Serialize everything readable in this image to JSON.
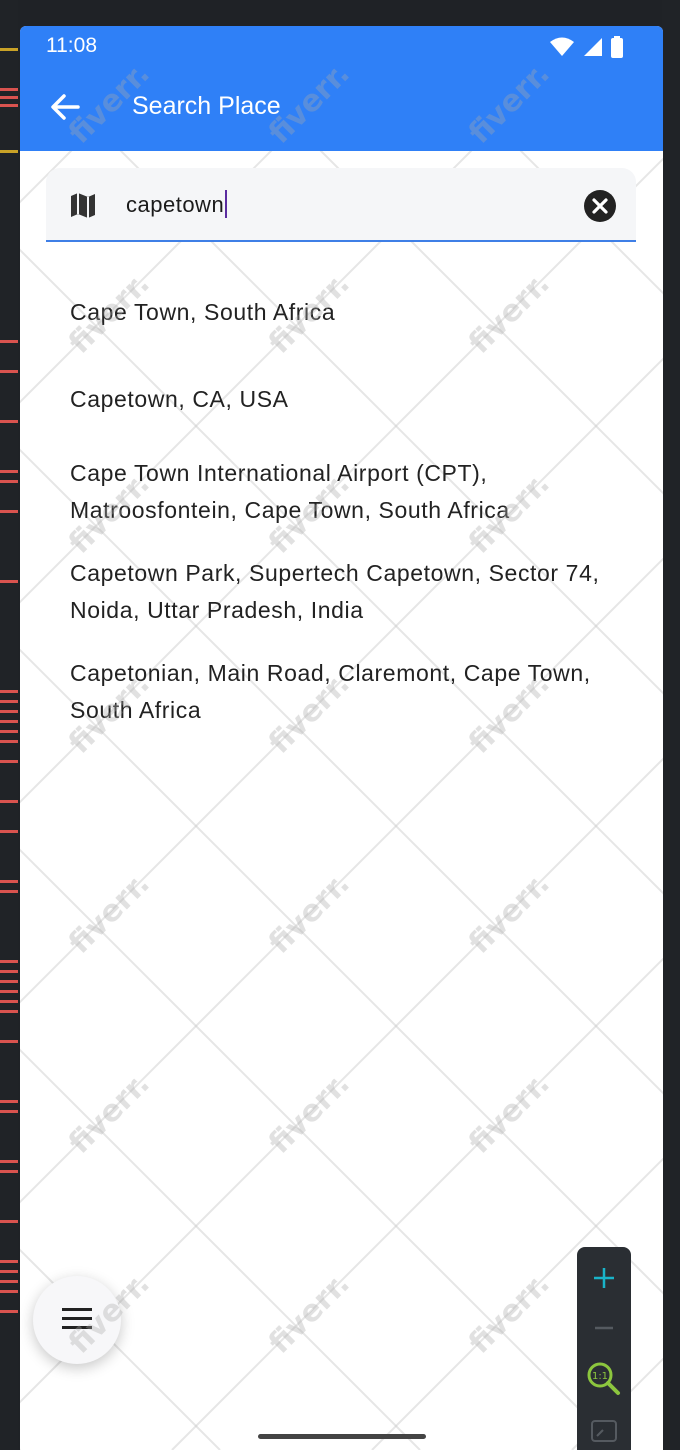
{
  "status_bar": {
    "time": "11:08"
  },
  "app_bar": {
    "title": "Search Place"
  },
  "search": {
    "query": "capetown"
  },
  "results": [
    "Cape Town, South Africa",
    "Capetown, CA, USA",
    "Cape Town International Airport (CPT), Matroosfontein, Cape Town, South Africa",
    "Capetown Park, Supertech Capetown, Sector 74, Noida, Uttar Pradesh, India",
    "Capetonian, Main Road, Claremont, Cape Town, South Africa"
  ],
  "zoom_controls": {
    "zoom_in": "+",
    "zoom_out": "−",
    "reset_label": "1:1"
  },
  "watermark": "fiverr.",
  "colors": {
    "app_bar": "#2f80f7",
    "search_underline": "#3f7fe6",
    "zoom_in": "#19b3c9",
    "zoom_reset": "#8cc63e"
  },
  "icons": [
    "arrow-back-icon",
    "map-icon",
    "clear-icon",
    "wifi-icon",
    "signal-icon",
    "battery-icon",
    "menu-icon",
    "zoom-fit-icon"
  ]
}
